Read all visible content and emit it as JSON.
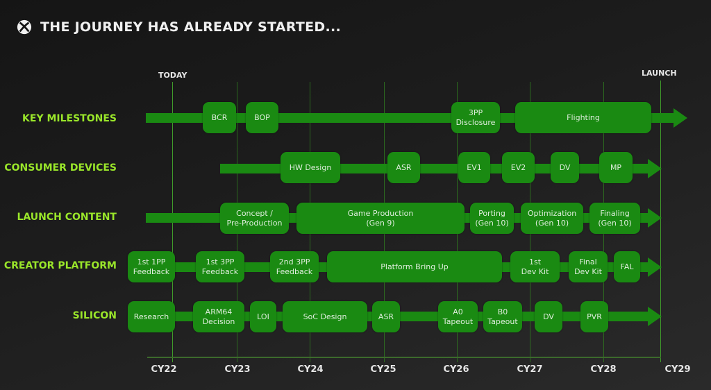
{
  "header": {
    "title": "THE JOURNEY HAS ALREADY STARTED...",
    "logo_icon": "xbox-logo-icon"
  },
  "markers": {
    "today": "TODAY",
    "launch": "LAUNCH"
  },
  "axis": {
    "ticks": [
      "CY22",
      "CY23",
      "CY24",
      "CY25",
      "CY26",
      "CY27",
      "CY28",
      "CY29"
    ]
  },
  "colors": {
    "track": "#1a8a12",
    "row_label": "#9ae62a",
    "grid": "#2f7d1f"
  },
  "rows": [
    {
      "label": "KEY MILESTONES",
      "items": [
        "BCR",
        "BOP",
        "3PP\nDisclosure",
        "Flighting"
      ]
    },
    {
      "label": "CONSUMER DEVICES",
      "items": [
        "HW Design",
        "ASR",
        "EV1",
        "EV2",
        "DV",
        "MP"
      ]
    },
    {
      "label": "LAUNCH CONTENT",
      "items": [
        "Concept /\nPre-Production",
        "Game Production\n(Gen 9)",
        "Porting\n(Gen 10)",
        "Optimization\n(Gen 10)",
        "Finaling\n(Gen 10)"
      ]
    },
    {
      "label": "CREATOR PLATFORM",
      "items": [
        "1st 1PP\nFeedback",
        "1st 3PP\nFeedback",
        "2nd 3PP\nFeedback",
        "Platform Bring Up",
        "1st\nDev Kit",
        "Final\nDev Kit",
        "FAL"
      ]
    },
    {
      "label": "SILICON",
      "items": [
        "Research",
        "ARM64\nDecision",
        "LOI",
        "SoC Design",
        "ASR",
        "A0\nTapeout",
        "B0\nTapeout",
        "DV",
        "PVR"
      ]
    }
  ]
}
